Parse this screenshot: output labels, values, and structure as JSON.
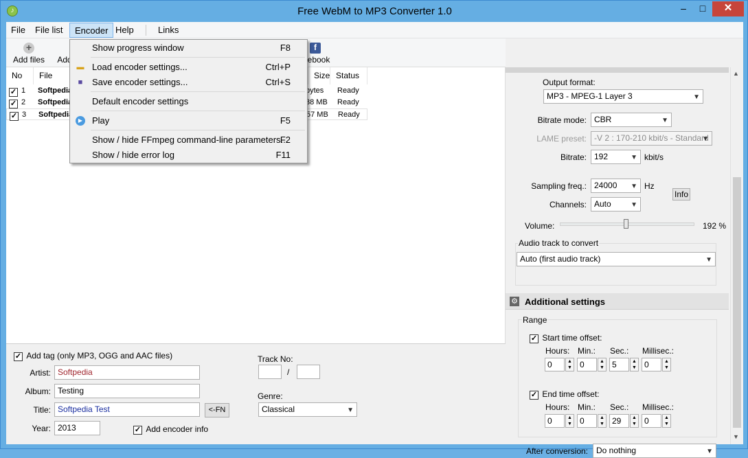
{
  "window": {
    "title": "Free WebM to MP3 Converter 1.0",
    "minimize": "–",
    "maximize": "□",
    "close": "✕"
  },
  "menubar": {
    "items": [
      "File",
      "File list",
      "Encoder",
      "Help",
      "Links"
    ]
  },
  "toolbar": {
    "add_files": "Add files",
    "add_folder_partial": "Add",
    "facebook_partial": "ebook"
  },
  "filelist": {
    "headers": {
      "no": "No",
      "file": "File",
      "size": "Size",
      "status": "Status"
    },
    "rows": [
      {
        "no": "1",
        "file": "Softpedia",
        "size": "bytes",
        "status": "Ready",
        "checked": true
      },
      {
        "no": "2",
        "file": "Softpedia",
        "size": "38 MB",
        "status": "Ready",
        "checked": true
      },
      {
        "no": "3",
        "file": "Softpedia",
        "size": "57 MB",
        "status": "Ready",
        "checked": true
      }
    ]
  },
  "encoder_menu": {
    "items": [
      {
        "label": "Show progress window",
        "key": "F8",
        "icon": ""
      },
      {
        "label": "Load encoder settings...",
        "key": "Ctrl+P",
        "icon": "folder-open-icon"
      },
      {
        "label": "Save encoder settings...",
        "key": "Ctrl+S",
        "icon": "floppy-disk-icon"
      },
      {
        "label": "Default encoder settings",
        "key": "",
        "icon": ""
      },
      {
        "label": "Play",
        "key": "F5",
        "icon": "play-icon"
      },
      {
        "label": "Show / hide FFmpeg command-line parameters...",
        "key": "F2",
        "icon": ""
      },
      {
        "label": "Show / hide error log",
        "key": "F11",
        "icon": ""
      }
    ]
  },
  "tags": {
    "add_tag_label": "Add tag (only MP3, OGG and AAC files)",
    "add_tag_checked": true,
    "artist_label": "Artist:",
    "artist_value": "Softpedia",
    "album_label": "Album:",
    "album_value": "Testing",
    "title_label": "Title:",
    "title_value": "Softpedia Test",
    "fn_button": "<-FN",
    "year_label": "Year:",
    "year_value": "2013",
    "add_encoder_info": "Add encoder info",
    "add_encoder_checked": true,
    "track_label": "Track No:",
    "track_sep": "/",
    "genre_label": "Genre:",
    "genre_value": "Classical"
  },
  "settings": {
    "output_format_label": "Output format:",
    "output_format_value": "MP3 - MPEG-1 Layer 3",
    "bitrate_mode_label": "Bitrate mode:",
    "bitrate_mode_value": "CBR",
    "lame_preset_label": "LAME preset:",
    "lame_preset_value": "-V 2 : 170-210 kbit/s - Standard",
    "bitrate_label": "Bitrate:",
    "bitrate_value": "192",
    "bitrate_unit": "kbit/s",
    "sampling_label": "Sampling freq.:",
    "sampling_value": "24000",
    "sampling_unit": "Hz",
    "info_button": "Info",
    "channels_label": "Channels:",
    "channels_value": "Auto",
    "volume_label": "Volume:",
    "volume_value": "192 %",
    "volume_level": 0.49,
    "audio_track_label": "Audio track to convert",
    "audio_track_value": "Auto (first audio track)"
  },
  "additional": {
    "header": "Additional settings",
    "range_label": "Range",
    "start_label": "Start time offset:",
    "start_checked": true,
    "end_label": "End time offset:",
    "end_checked": true,
    "col_hours": "Hours:",
    "col_min": "Min.:",
    "col_sec": "Sec.:",
    "col_ms": "Millisec.:",
    "start": {
      "h": "0",
      "m": "0",
      "s": "5",
      "ms": "0"
    },
    "end": {
      "h": "0",
      "m": "0",
      "s": "29",
      "ms": "0"
    },
    "after_label": "After conversion:",
    "after_value": "Do nothing"
  }
}
